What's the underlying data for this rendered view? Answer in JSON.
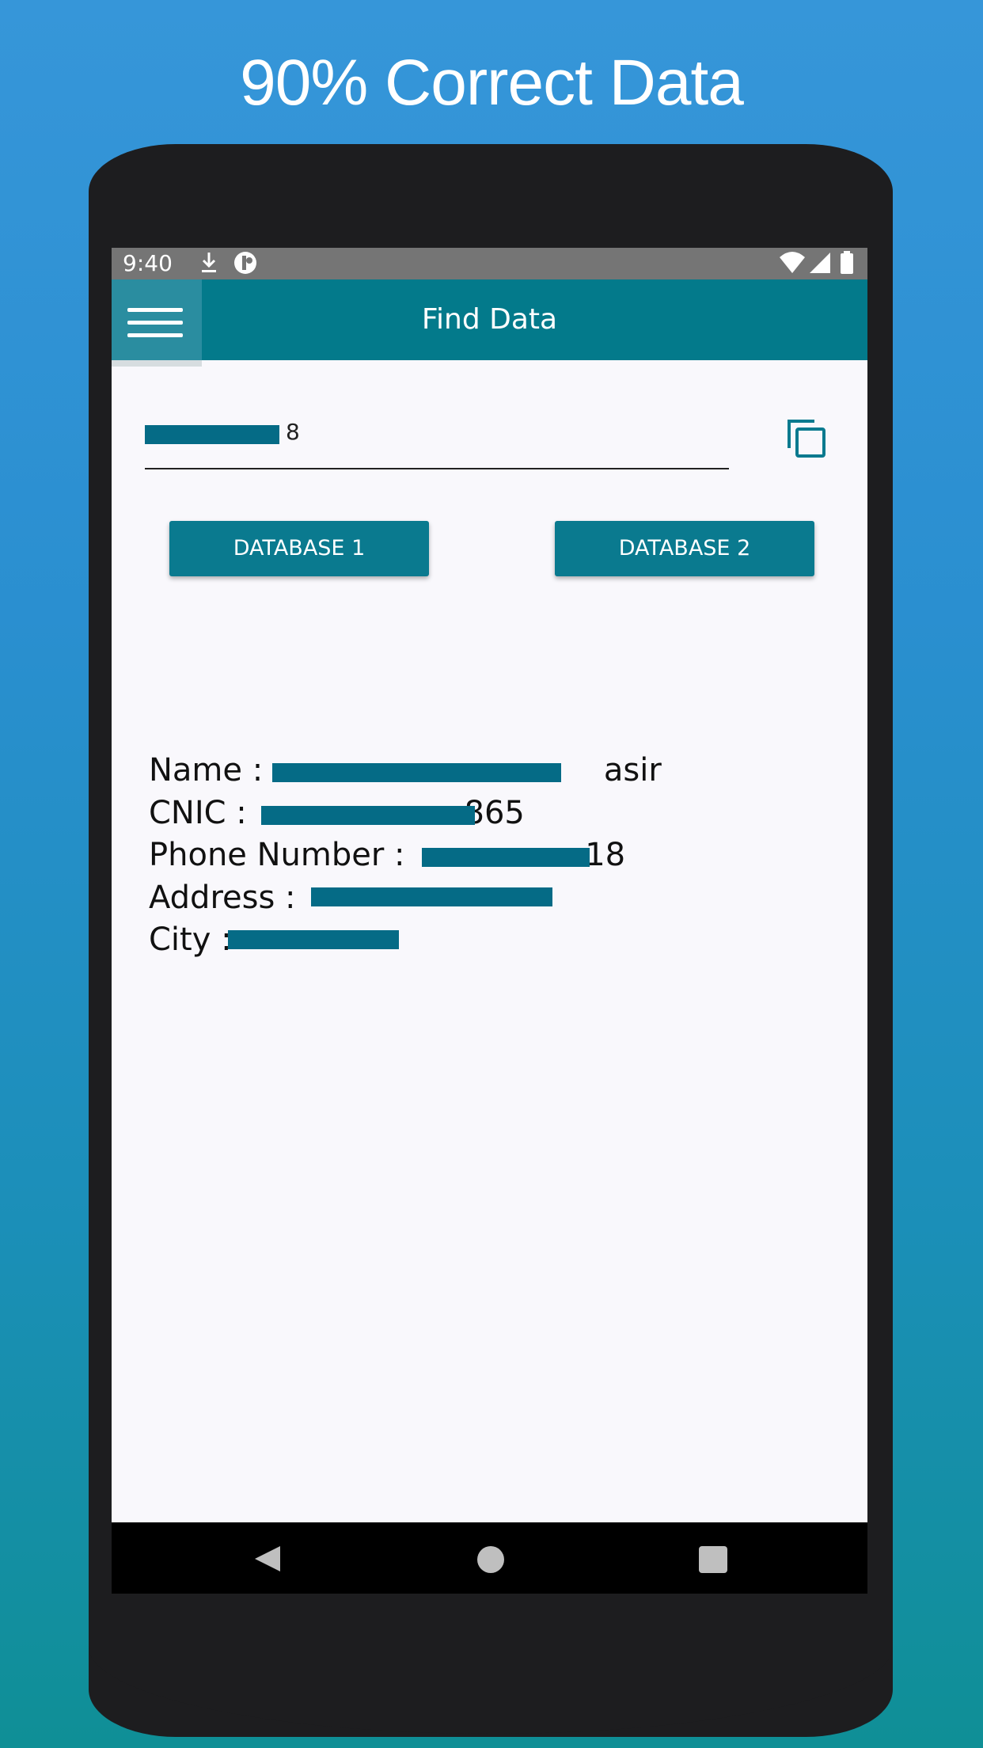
{
  "headline": "90% Correct Data",
  "status_bar": {
    "time": "9:40"
  },
  "app_bar": {
    "title": "Find Data"
  },
  "search": {
    "value_visible": "8"
  },
  "buttons": {
    "db1": "DATABASE 1",
    "db2": "DATABASE 2"
  },
  "result": {
    "name_label": "Name :",
    "name_tail": "asir",
    "cnic_label": "CNIC :",
    "cnic_tail": "865",
    "phone_label": "Phone Number :",
    "phone_tail": "18",
    "address_label": "Address :",
    "city_label": "City :"
  },
  "colors": {
    "accent": "#037a8b",
    "redaction": "#056b86"
  }
}
